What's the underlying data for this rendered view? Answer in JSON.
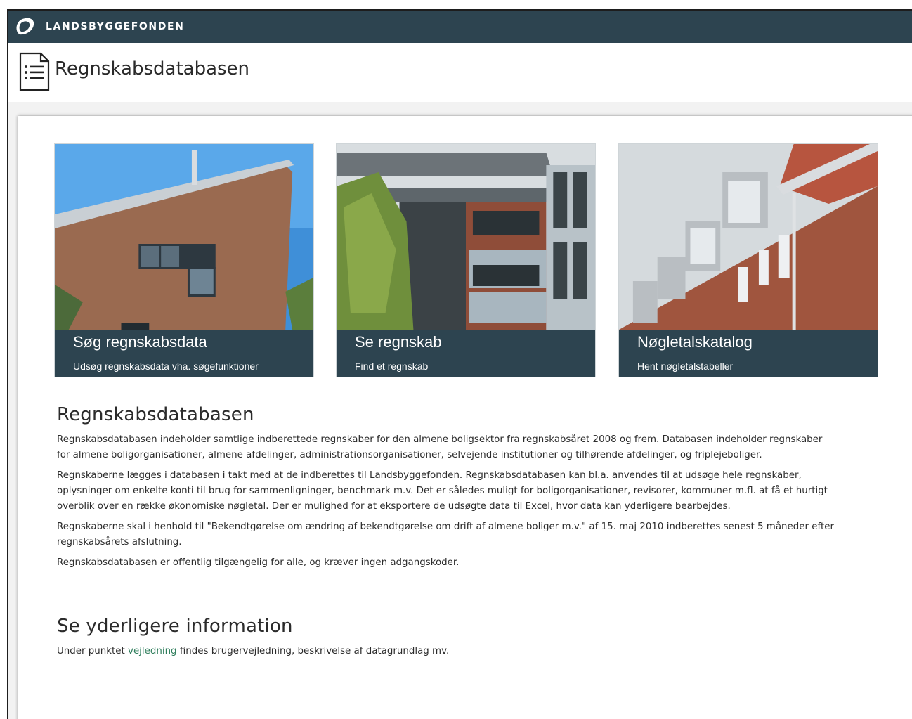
{
  "topbar": {
    "brand": "LANDSBYGGEFONDEN",
    "logo_icon": "landsbyggefonden-logo-icon"
  },
  "header": {
    "title": "Regnskabsdatabasen",
    "icon": "document-list-icon"
  },
  "tiles": [
    {
      "title": "Søg regnskabsdata",
      "subtitle": "Udsøg regnskabsdata vha. søgefunktioner"
    },
    {
      "title": "Se regnskab",
      "subtitle": "Find et regnskab"
    },
    {
      "title": "Nøgletalskatalog",
      "subtitle": "Hent nøgletalstabeller"
    }
  ],
  "about": {
    "heading": "Regnskabsdatabasen",
    "paragraphs": [
      "Regnskabsdatabasen indeholder samtlige indberettede regnskaber for den almene boligsektor fra regnskabsåret 2008 og frem. Databasen indeholder regnskaber for almene boligorganisationer, almene afdelinger, administrationsorganisationer, selvejende institutioner og tilhørende afdelinger, og friplejeboliger.",
      "Regnskaberne lægges i databasen i takt med at de indberettes til Landsbyggefonden. Regnskabsdatabasen kan bl.a. anvendes til at udsøge hele regnskaber, oplysninger om enkelte konti til brug for sammenligninger, benchmark m.v. Det er således muligt for boligorganisationer, revisorer, kommuner m.fl. at få et hurtigt overblik over en række økonomiske nøgletal. Der er mulighed for at eksportere de udsøgte data til Excel, hvor data kan yderligere bearbejdes.",
      "Regnskaberne skal i henhold til \"Bekendtgørelse om ændring af bekendtgørelse om drift af almene boliger m.v.\" af 15. maj 2010 indberettes senest 5 måneder efter regnskabsårets afslutning.",
      "Regnskabsdatabasen er offentlig tilgængelig for alle, og kræver ingen adgangskoder."
    ]
  },
  "more_info": {
    "heading": "Se yderligere information",
    "text_before": "Under punktet ",
    "link_text": "vejledning",
    "text_after": " findes brugervejledning, beskrivelse af datagrundlag mv."
  },
  "colors": {
    "topbar": "#2d4450",
    "tile_caption": "#2d4450",
    "link": "#2e7d5b"
  }
}
